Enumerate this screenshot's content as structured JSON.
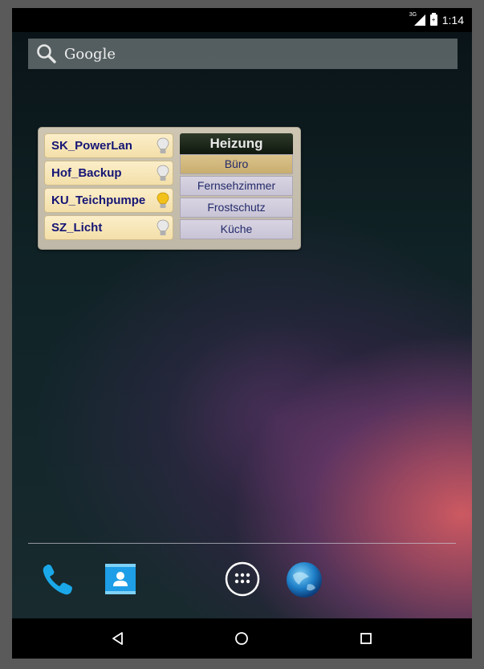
{
  "status_bar": {
    "network": "3G",
    "time": "1:14",
    "battery_symbol": "+"
  },
  "search": {
    "label": "Google",
    "icon": "search-icon"
  },
  "switches": [
    {
      "label": "SK_PowerLan",
      "state": "off",
      "icon": "bulb-off-icon"
    },
    {
      "label": "Hof_Backup",
      "state": "off",
      "icon": "bulb-off-icon"
    },
    {
      "label": "KU_Teichpumpe",
      "state": "on",
      "icon": "bulb-on-icon"
    },
    {
      "label": "SZ_Licht",
      "state": "off",
      "icon": "bulb-off-icon"
    }
  ],
  "heating": {
    "title": "Heizung",
    "options": [
      {
        "label": "Büro",
        "selected": true
      },
      {
        "label": "Fernsehzimmer",
        "selected": false
      },
      {
        "label": "Frostschutz",
        "selected": false
      },
      {
        "label": "Küche",
        "selected": false
      }
    ]
  },
  "dock": [
    "phone-icon",
    "contacts-icon",
    "app-drawer-icon",
    "browser-icon"
  ],
  "navbar": [
    "back-icon",
    "home-icon",
    "recents-icon"
  ],
  "colors": {
    "switch_text": "#151575",
    "heat_active": "#c9ae70",
    "bulb_on": "#f2c21a"
  }
}
